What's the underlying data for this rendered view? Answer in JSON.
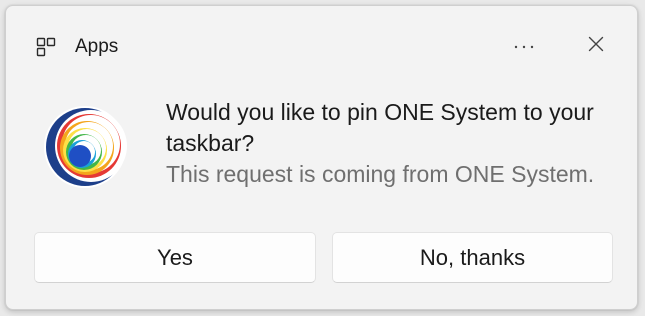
{
  "header": {
    "title": "Apps",
    "app_icon": "apps-grid-icon",
    "more_icon": "more-options-icon",
    "close_icon": "close-icon"
  },
  "logo": {
    "icon": "one-system-logo",
    "colors": [
      "#e53935",
      "#f4a51c",
      "#fde047",
      "#43b649",
      "#1aa0d8",
      "#1f4fc4"
    ]
  },
  "message": {
    "question": "Would you like to pin ONE System to your taskbar?",
    "subtext": "This request is coming from ONE System."
  },
  "buttons": {
    "yes_label": "Yes",
    "no_label": "No, thanks"
  }
}
